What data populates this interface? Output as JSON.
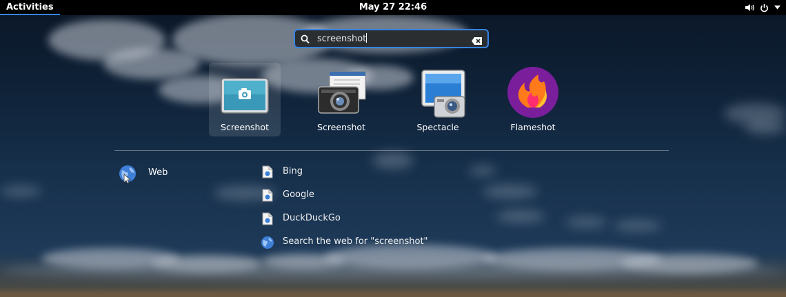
{
  "topbar": {
    "activities": "Activities",
    "clock": "May 27  22:46",
    "icons": [
      "volume-icon",
      "power-icon",
      "menu-down-icon"
    ]
  },
  "search": {
    "value": "screenshot",
    "icons": [
      "search-icon",
      "clear-icon"
    ]
  },
  "apps": [
    {
      "label": "Screenshot",
      "icon": "gnome-screenshot-icon"
    },
    {
      "label": "Screenshot",
      "icon": "camera-screenshot-icon"
    },
    {
      "label": "Spectacle",
      "icon": "spectacle-icon"
    },
    {
      "label": "Flameshot",
      "icon": "flameshot-icon"
    }
  ],
  "provider": {
    "label": "Web",
    "icon": "web-globe-icon"
  },
  "results": [
    {
      "label": "Bing",
      "icon": "document-icon"
    },
    {
      "label": "Google",
      "icon": "document-icon"
    },
    {
      "label": "DuckDuckGo",
      "icon": "document-icon"
    },
    {
      "label": "Search the web for \"screenshot\"",
      "icon": "globe-icon"
    }
  ],
  "colors": {
    "accent": "#3584e4",
    "topbar": "#000000",
    "flameshot_bg": "#7a1e9c"
  }
}
